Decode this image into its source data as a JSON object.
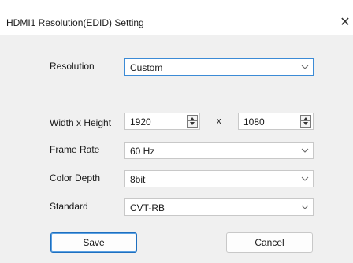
{
  "dialog": {
    "title": "HDMI1 Resolution(EDID) Setting",
    "close_symbol": "✕"
  },
  "form": {
    "resolution": {
      "label": "Resolution",
      "value": "Custom"
    },
    "size": {
      "label": "Width x Height",
      "width": "1920",
      "separator": "x",
      "height": "1080"
    },
    "frame_rate": {
      "label": "Frame Rate",
      "value": "60 Hz"
    },
    "color_depth": {
      "label": "Color Depth",
      "value": "8bit"
    },
    "standard": {
      "label": "Standard",
      "value": "CVT-RB"
    }
  },
  "buttons": {
    "save": "Save",
    "cancel": "Cancel"
  },
  "colors": {
    "dialog_bg": "#f0f0f0",
    "focus_border": "#3c8bd6",
    "primary_border": "#1e6fbf"
  },
  "icons": [
    "close-icon",
    "chevron-down-icon",
    "spin-up-icon",
    "spin-down-icon"
  ]
}
